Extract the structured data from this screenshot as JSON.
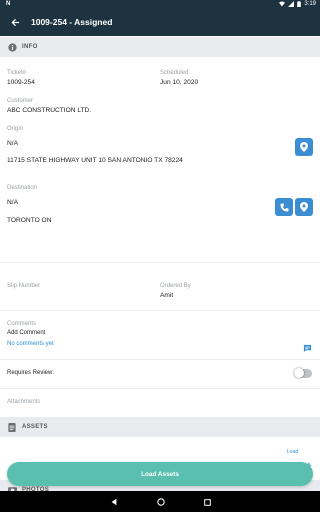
{
  "status_bar": {
    "left_icons": "N",
    "time": "3:19"
  },
  "app_bar": {
    "title": "1009-254 - Assigned"
  },
  "info_section": {
    "label": "INFO"
  },
  "ticket": {
    "label": "Ticket#",
    "value": "1009-254"
  },
  "scheduled": {
    "label": "Scheduled",
    "value": "Jun 10, 2020"
  },
  "customer": {
    "label": "Customer",
    "value": "ABC CONSTRUCTION LTD."
  },
  "origin": {
    "label": "Origin",
    "name": "N/A",
    "address": "11715 STATE HIGHWAY UNIT 10 SAN ANTONIO TX 78224"
  },
  "destination": {
    "label": "Destination",
    "name": "N/A",
    "address": "TORONTO ON"
  },
  "slip": {
    "label": "Slip Number",
    "value": ""
  },
  "ordered_by": {
    "label": "Ordered By",
    "value": "Amit"
  },
  "comments": {
    "label": "Comments",
    "add_label": "Add Comment",
    "empty_text": "No comments yet"
  },
  "requires_review": {
    "label": "Requires Review:",
    "enabled": false
  },
  "attachments": {
    "label": "Attachments"
  },
  "assets_section": {
    "label": "ASSETS",
    "load_link": "Load"
  },
  "photos_section": {
    "label": "PHOTOS"
  },
  "load_assets_button": {
    "label": "Load Assets"
  },
  "colors": {
    "appbar": "#1d3340",
    "accent": "#3a8ed1",
    "primary_button": "#5bbfb0",
    "link": "#2a8fd8"
  }
}
